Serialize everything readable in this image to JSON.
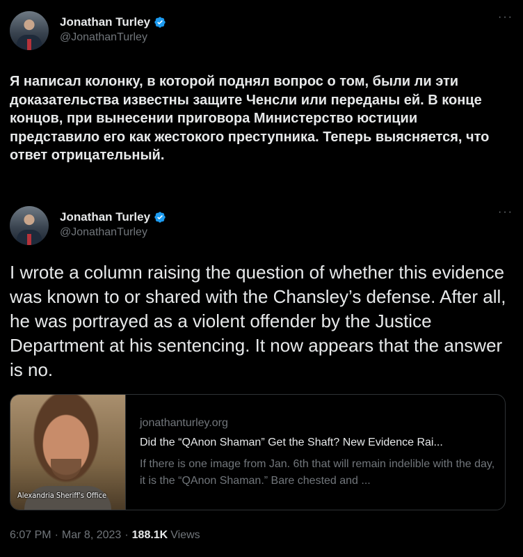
{
  "tweet1": {
    "author": {
      "name": "Jonathan Turley",
      "handle": "@JonathanTurley"
    },
    "more": "···",
    "text": "Я написал колонку, в которой поднял вопрос о том, были ли эти доказательства известны защите Ченсли или переданы ей. В конце концов, при вынесении приговора Министерство юстиции представило его как жестокого преступника. Теперь выясняется, что ответ отрицательный."
  },
  "tweet2": {
    "author": {
      "name": "Jonathan Turley",
      "handle": "@JonathanTurley"
    },
    "more": "···",
    "text": "I wrote a column raising the question of whether this evidence was known to or shared with the Chansley’s defense. After all, he was portrayed as a violent offender by the Justice Department at his sentencing. It now appears that the answer is no.",
    "card": {
      "image_caption": "Alexandria Sheriff's Office",
      "domain": "jonathanturley.org",
      "title": "Did the “QAnon Shaman” Get the Shaft? New Evidence Rai...",
      "description": "If there is one image from Jan. 6th that will remain indelible with the day, it is the “QAnon Shaman.” Bare chested and ..."
    },
    "meta": {
      "time": "6:07 PM",
      "date": "Mar 8, 2023",
      "views_count": "188.1K",
      "views_label": "Views"
    }
  },
  "colors": {
    "verified": "#1d9bf0",
    "secondary_text": "#71767b",
    "background": "#000000"
  },
  "icons": {
    "verified": "verified-badge-icon",
    "more": "more-options-icon"
  }
}
